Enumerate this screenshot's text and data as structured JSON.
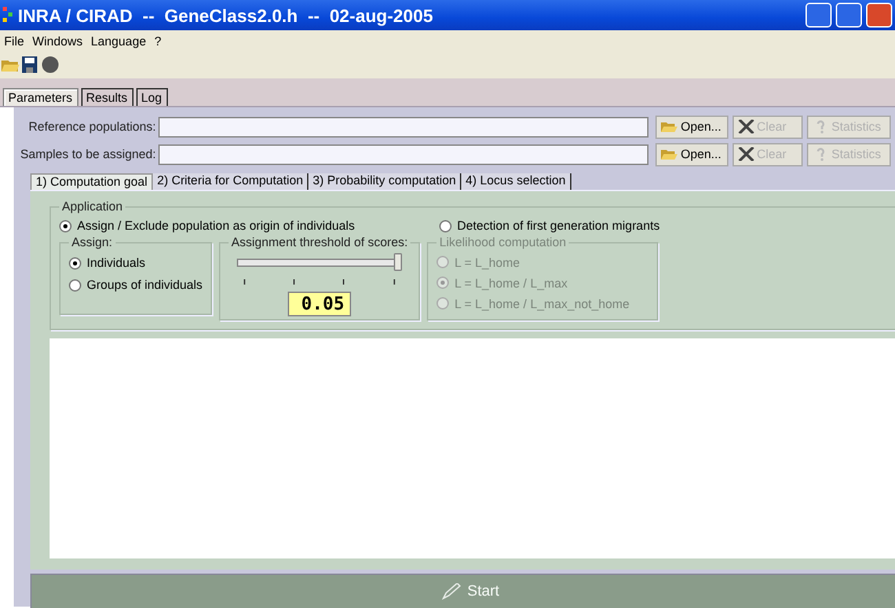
{
  "window": {
    "title": "INRA / CIRAD  --  GeneClass2.0.h  --  02-aug-2005"
  },
  "menu": [
    "File",
    "Windows",
    "Language",
    "?"
  ],
  "main_tabs": [
    {
      "label": "Parameters",
      "selected": true
    },
    {
      "label": "Results",
      "selected": false
    },
    {
      "label": "Log",
      "selected": false
    }
  ],
  "file_rows": [
    {
      "label": "Reference populations:",
      "buttons": [
        {
          "kind": "open",
          "label": "Open...",
          "disabled": false
        },
        {
          "kind": "clear",
          "label": "Clear",
          "disabled": true
        },
        {
          "kind": "stats",
          "label": "Statistics",
          "disabled": true
        }
      ]
    },
    {
      "label": "Samples to be assigned:",
      "buttons": [
        {
          "kind": "open",
          "label": "Open...",
          "disabled": false
        },
        {
          "kind": "clear",
          "label": "Clear",
          "disabled": true
        },
        {
          "kind": "stats",
          "label": "Statistics",
          "disabled": true
        }
      ]
    }
  ],
  "sub_tabs": [
    {
      "label": "1) Computation goal",
      "selected": true
    },
    {
      "label": "2) Criteria for Computation",
      "selected": false
    },
    {
      "label": "3) Probability computation",
      "selected": false
    },
    {
      "label": "4) Locus selection",
      "selected": false
    }
  ],
  "application": {
    "legend": "Application",
    "modes": [
      {
        "label": "Assign / Exclude population as origin of individuals",
        "selected": true
      },
      {
        "label": "Detection of first generation migrants",
        "selected": false
      }
    ],
    "assign": {
      "legend": "Assign:",
      "options": [
        {
          "label": "Individuals",
          "selected": true
        },
        {
          "label": "Groups of individuals",
          "selected": false
        }
      ]
    },
    "threshold": {
      "legend": "Assignment threshold of scores:",
      "level": 1,
      "value": "0.05"
    },
    "likelihood": {
      "legend": "Likelihood computation",
      "disabled": true,
      "options": [
        {
          "label": "L = L_home",
          "selected": false
        },
        {
          "label": "L = L_home / L_max",
          "selected": true
        },
        {
          "label": "L = L_home / L_max_not_home",
          "selected": false
        }
      ]
    }
  },
  "start": {
    "label": "Start",
    "disabled": true
  }
}
